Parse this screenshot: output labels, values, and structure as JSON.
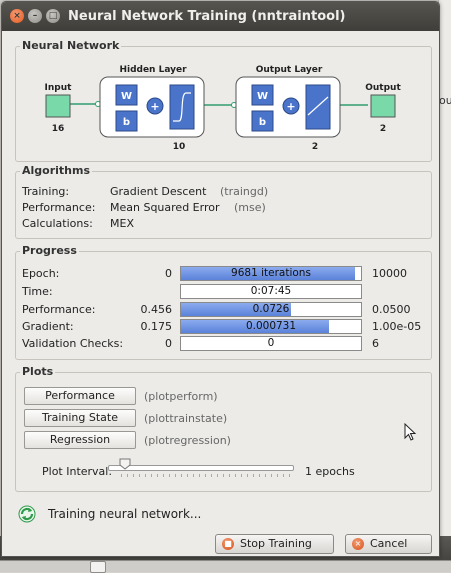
{
  "window": {
    "title": "Neural Network Training (nntraintool)",
    "close_glyph": "×",
    "min_glyph": "–",
    "max_glyph": "□"
  },
  "background": {
    "side_text": "ou"
  },
  "network": {
    "section_title": "Neural Network",
    "input_label": "Input",
    "input_size": "16",
    "hidden_title": "Hidden Layer",
    "hidden_size": "10",
    "output_title": "Output Layer",
    "output_size": "2",
    "output_label": "Output",
    "output_count": "2",
    "weight_label": "W",
    "bias_label": "b",
    "sum_label": "+"
  },
  "algorithms": {
    "section_title": "Algorithms",
    "rows": [
      {
        "label": "Training:",
        "value": "Gradient Descent",
        "detail": "(traingd)"
      },
      {
        "label": "Performance:",
        "value": "Mean Squared Error",
        "detail": "(mse)"
      },
      {
        "label": "Calculations:",
        "value": "MEX",
        "detail": ""
      }
    ]
  },
  "progress": {
    "section_title": "Progress",
    "rows": [
      {
        "label": "Epoch:",
        "start": "0",
        "bar_text": "9681 iterations",
        "fill": 0.968,
        "end": "10000"
      },
      {
        "label": "Time:",
        "start": "",
        "bar_text": "0:07:45",
        "fill": 0,
        "end": ""
      },
      {
        "label": "Performance:",
        "start": "0.456",
        "bar_text": "0.0726",
        "fill": 0.61,
        "end": "0.0500"
      },
      {
        "label": "Gradient:",
        "start": "0.175",
        "bar_text": "0.000731",
        "fill": 0.82,
        "end": "1.00e-05"
      },
      {
        "label": "Validation Checks:",
        "start": "0",
        "bar_text": "0",
        "fill": 0,
        "end": "6"
      }
    ]
  },
  "plots": {
    "section_title": "Plots",
    "buttons": [
      {
        "label": "Performance",
        "fn": "(plotperform)"
      },
      {
        "label": "Training State",
        "fn": "(plottrainstate)"
      },
      {
        "label": "Regression",
        "fn": "(plotregression)"
      }
    ],
    "interval_label": "Plot Interval:",
    "interval_value": "1 epochs"
  },
  "status": {
    "text": "Training neural network..."
  },
  "actions": {
    "stop_label": "Stop Training",
    "stop_icon_glyph": "■",
    "cancel_label": "Cancel",
    "cancel_icon_glyph": "×"
  },
  "colors": {
    "bar_fill": "#6a8fe0",
    "node_green": "#79d9a8",
    "block_blue": "#4a74c9",
    "wire_green": "#2e9e6e"
  }
}
